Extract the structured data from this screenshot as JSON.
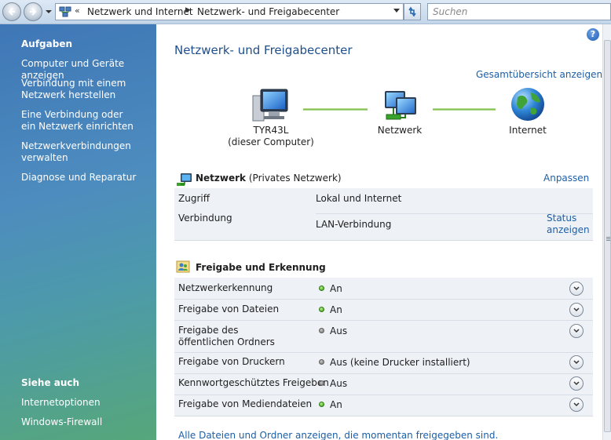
{
  "address_bar": {
    "breadcrumb_1": "Netzwerk und Internet",
    "breadcrumb_2": "Netzwerk- und Freigabecenter",
    "search_placeholder": "Suchen"
  },
  "sidebar": {
    "tasks_heading": "Aufgaben",
    "tasks": [
      "Computer und Geräte anzeigen",
      "Verbindung mit einem Netzwerk herstellen",
      "Eine Verbindung oder ein Netzwerk einrichten",
      "Netzwerkverbindungen verwalten",
      "Diagnose und Reparatur"
    ],
    "see_also_heading": "Siehe auch",
    "see_also": [
      "Internetoptionen",
      "Windows-Firewall"
    ]
  },
  "main": {
    "title": "Netzwerk- und Freigabecenter",
    "overview_link": "Gesamtübersicht anzeigen",
    "map": {
      "computer_name": "TYR43L",
      "computer_sub": "(dieser Computer)",
      "network": "Netzwerk",
      "internet": "Internet"
    },
    "network_section": {
      "name": "Netzwerk",
      "type": "(Privates Netzwerk)",
      "customize_link": "Anpassen",
      "rows": [
        {
          "label": "Zugriff",
          "value": "Lokal und Internet"
        },
        {
          "label": "Verbindung",
          "value": "LAN-Verbindung"
        }
      ],
      "status_link": "Status anzeigen"
    },
    "sharing_section": {
      "heading": "Freigabe und Erkennung",
      "rows": [
        {
          "label": "Netzwerkerkennung",
          "status": "An"
        },
        {
          "label": "Freigabe von Dateien",
          "status": "An"
        },
        {
          "label": "Freigabe des öffentlichen Ordners",
          "status": "Aus"
        },
        {
          "label": "Freigabe von Druckern",
          "status": "Aus (keine Drucker installiert)"
        },
        {
          "label": "Kennwortgeschütztes Freigeben",
          "status": "Aus"
        },
        {
          "label": "Freigabe von Mediendateien",
          "status": "An"
        }
      ]
    },
    "footer_link": "Alle Dateien und Ordner anzeigen, die momentan freigegeben sind."
  },
  "colors": {
    "link": "#1c5fa7",
    "title": "#1f4f8a",
    "status_on": "#2f9a13",
    "status_off": "#707070"
  }
}
